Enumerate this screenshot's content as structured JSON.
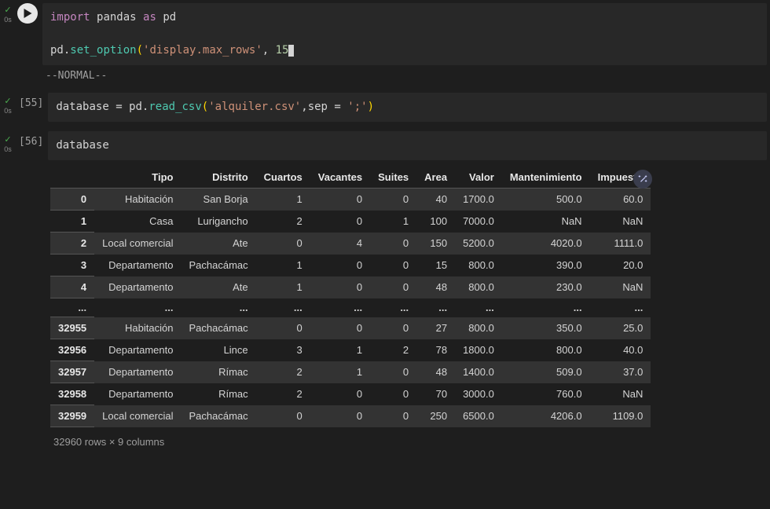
{
  "cells": {
    "c1": {
      "status_icon": "✓",
      "exec_time": "0s",
      "code_line1_parts": {
        "kw1": "import",
        "mod": "pandas",
        "kw2": "as",
        "alias": "pd"
      },
      "code_line2_parts": {
        "obj": "pd",
        "func": "set_option",
        "str_arg": "'display.max_rows'",
        "num_arg": "15"
      },
      "mode_text": "--NORMAL--"
    },
    "c2": {
      "status_icon": "✓",
      "exec_time": "0s",
      "prompt": "[55]",
      "code_parts": {
        "var": "database",
        "eq": "=",
        "obj": "pd",
        "func": "read_csv",
        "str1": "'alquiler.csv'",
        "arg": "sep",
        "str2": "';'"
      }
    },
    "c3": {
      "status_icon": "✓",
      "exec_time": "0s",
      "prompt": "[56]",
      "code": "database"
    }
  },
  "table": {
    "columns": [
      "Tipo",
      "Distrito",
      "Cuartos",
      "Vacantes",
      "Suites",
      "Area",
      "Valor",
      "Mantenimiento",
      "Impuesto"
    ],
    "top_rows": [
      {
        "idx": "0",
        "Tipo": "Habitación",
        "Distrito": "San Borja",
        "Cuartos": "1",
        "Vacantes": "0",
        "Suites": "0",
        "Area": "40",
        "Valor": "1700.0",
        "Mantenimiento": "500.0",
        "Impuesto": "60.0"
      },
      {
        "idx": "1",
        "Tipo": "Casa",
        "Distrito": "Lurigancho",
        "Cuartos": "2",
        "Vacantes": "0",
        "Suites": "1",
        "Area": "100",
        "Valor": "7000.0",
        "Mantenimiento": "NaN",
        "Impuesto": "NaN"
      },
      {
        "idx": "2",
        "Tipo": "Local comercial",
        "Distrito": "Ate",
        "Cuartos": "0",
        "Vacantes": "4",
        "Suites": "0",
        "Area": "150",
        "Valor": "5200.0",
        "Mantenimiento": "4020.0",
        "Impuesto": "1111.0"
      },
      {
        "idx": "3",
        "Tipo": "Departamento",
        "Distrito": "Pachacámac",
        "Cuartos": "1",
        "Vacantes": "0",
        "Suites": "0",
        "Area": "15",
        "Valor": "800.0",
        "Mantenimiento": "390.0",
        "Impuesto": "20.0"
      },
      {
        "idx": "4",
        "Tipo": "Departamento",
        "Distrito": "Ate",
        "Cuartos": "1",
        "Vacantes": "0",
        "Suites": "0",
        "Area": "48",
        "Valor": "800.0",
        "Mantenimiento": "230.0",
        "Impuesto": "NaN"
      }
    ],
    "ellipsis": "...",
    "bottom_rows": [
      {
        "idx": "32955",
        "Tipo": "Habitación",
        "Distrito": "Pachacámac",
        "Cuartos": "0",
        "Vacantes": "0",
        "Suites": "0",
        "Area": "27",
        "Valor": "800.0",
        "Mantenimiento": "350.0",
        "Impuesto": "25.0"
      },
      {
        "idx": "32956",
        "Tipo": "Departamento",
        "Distrito": "Lince",
        "Cuartos": "3",
        "Vacantes": "1",
        "Suites": "2",
        "Area": "78",
        "Valor": "1800.0",
        "Mantenimiento": "800.0",
        "Impuesto": "40.0"
      },
      {
        "idx": "32957",
        "Tipo": "Departamento",
        "Distrito": "Rímac",
        "Cuartos": "2",
        "Vacantes": "1",
        "Suites": "0",
        "Area": "48",
        "Valor": "1400.0",
        "Mantenimiento": "509.0",
        "Impuesto": "37.0"
      },
      {
        "idx": "32958",
        "Tipo": "Departamento",
        "Distrito": "Rímac",
        "Cuartos": "2",
        "Vacantes": "0",
        "Suites": "0",
        "Area": "70",
        "Valor": "3000.0",
        "Mantenimiento": "760.0",
        "Impuesto": "NaN"
      },
      {
        "idx": "32959",
        "Tipo": "Local comercial",
        "Distrito": "Pachacámac",
        "Cuartos": "0",
        "Vacantes": "0",
        "Suites": "0",
        "Area": "250",
        "Valor": "6500.0",
        "Mantenimiento": "4206.0",
        "Impuesto": "1109.0"
      }
    ],
    "shape_text": "32960 rows × 9 columns"
  }
}
